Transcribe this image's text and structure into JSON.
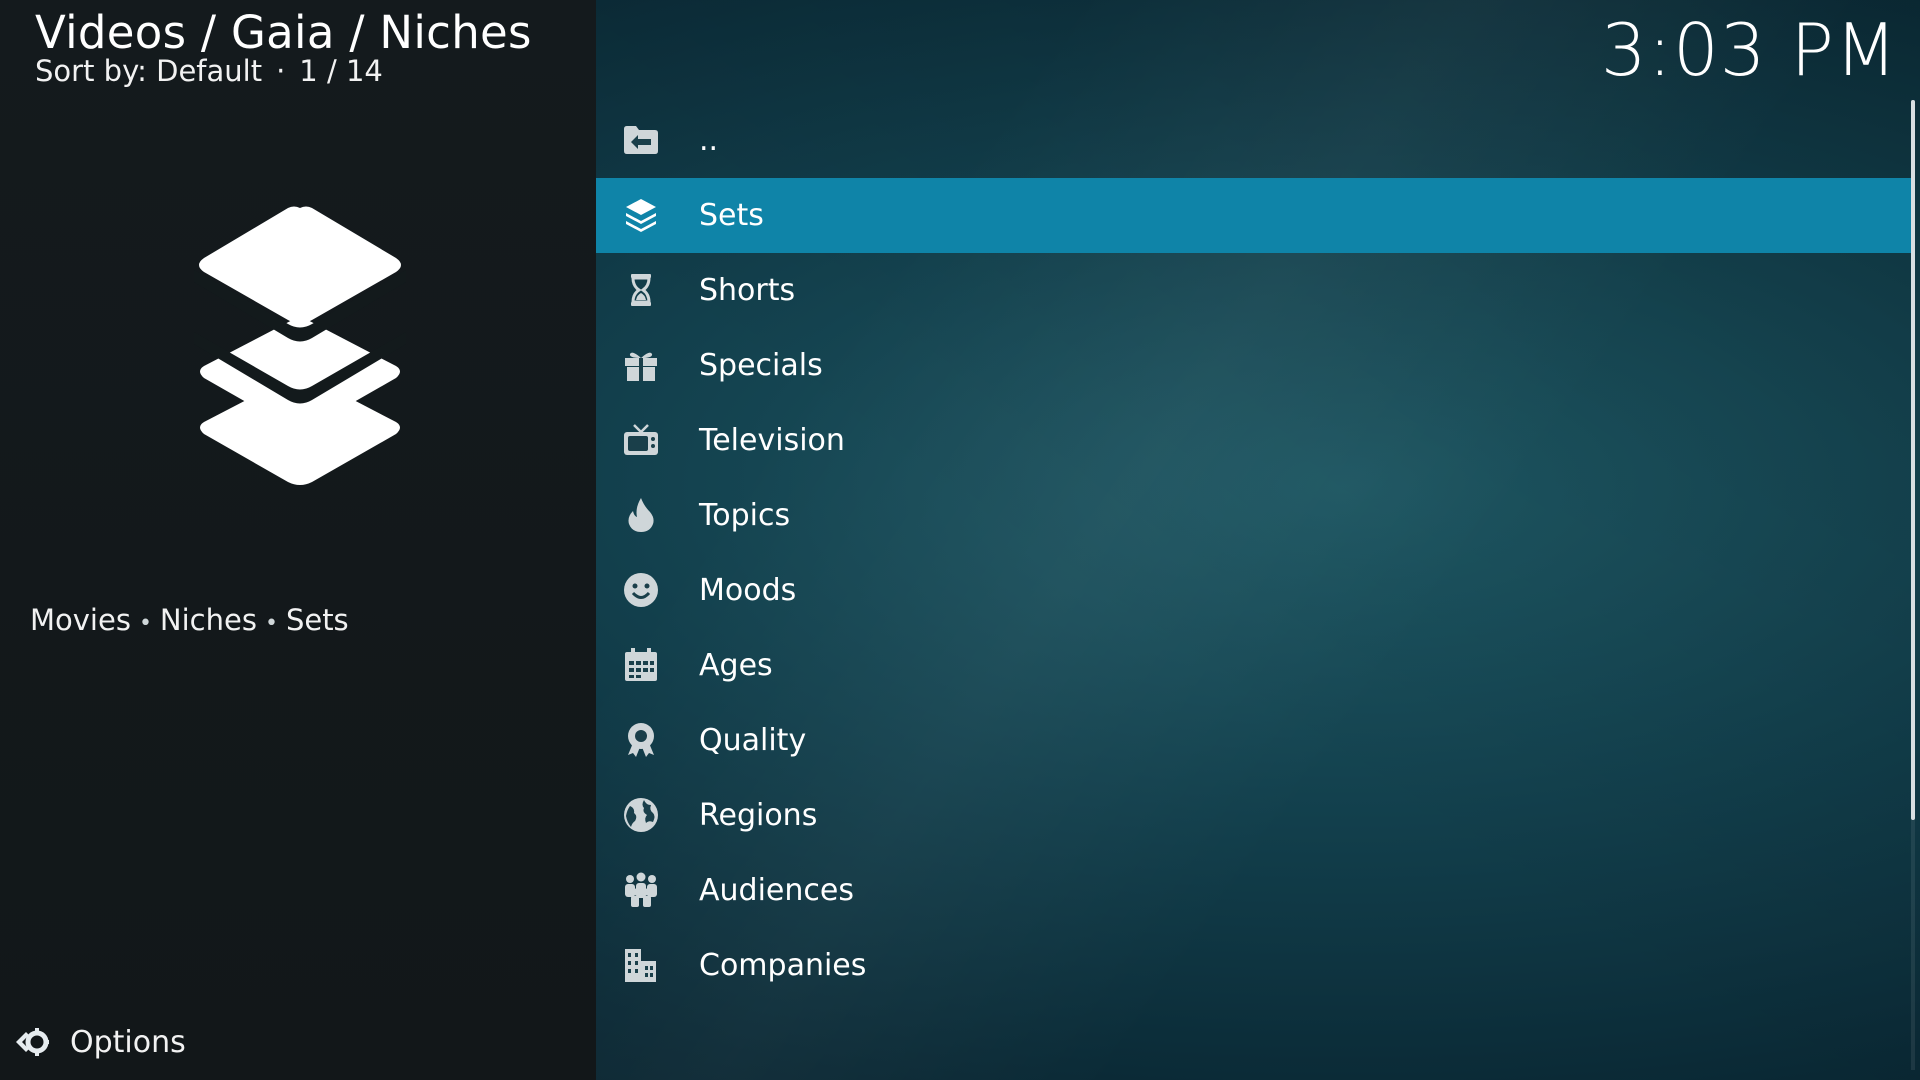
{
  "header": {
    "breadcrumb": "Videos / Gaia / Niches",
    "sort_label": "Sort by: Default",
    "separator": "·",
    "position": "1 / 14",
    "clock": "3:03 PM"
  },
  "info_panel": {
    "icon": "layers-icon",
    "tags": [
      "Movies",
      "Niches",
      "Sets"
    ],
    "tag_separator": "•"
  },
  "list": {
    "selected_index": 1,
    "items": [
      {
        "label": "..",
        "icon": "folder-back-icon"
      },
      {
        "label": "Sets",
        "icon": "layers-icon"
      },
      {
        "label": "Shorts",
        "icon": "hourglass-icon"
      },
      {
        "label": "Specials",
        "icon": "gift-icon"
      },
      {
        "label": "Television",
        "icon": "tv-icon"
      },
      {
        "label": "Topics",
        "icon": "flame-icon"
      },
      {
        "label": "Moods",
        "icon": "smiley-icon"
      },
      {
        "label": "Ages",
        "icon": "calendar-icon"
      },
      {
        "label": "Quality",
        "icon": "award-icon"
      },
      {
        "label": "Regions",
        "icon": "globe-icon"
      },
      {
        "label": "Audiences",
        "icon": "people-icon"
      },
      {
        "label": "Companies",
        "icon": "buildings-icon"
      }
    ]
  },
  "footer": {
    "options_label": "Options",
    "options_icon": "options-gear-icon"
  },
  "colors": {
    "selection": "#0f84a8",
    "panel": "#141a1d",
    "icon": "#cfd6d9"
  }
}
